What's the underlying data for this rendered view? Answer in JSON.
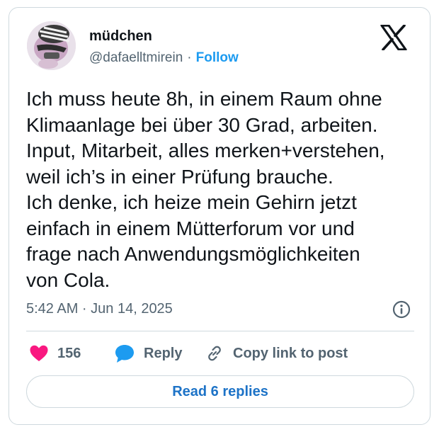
{
  "author": {
    "display_name": "müdchen",
    "handle": "@dafaelltmirein",
    "separator": "·",
    "follow_label": "Follow"
  },
  "tweet": {
    "text": "Ich muss heute 8h, in einem Raum ohne\nKlimaanlage bei über 30 Grad, arbeiten.\nInput, Mitarbeit, alles merken+verstehen,\nweil ich’s in einer Prüfung brauche.\nIch denke, ich heize mein Gehirn jetzt\neinfach in einem Mütterforum vor und\nfrage nach Anwendungsmöglichkeiten\nvon Cola.",
    "timestamp": "5:42 AM · Jun 14, 2025"
  },
  "actions": {
    "like_count": "156",
    "reply_label": "Reply",
    "copy_label": "Copy link to post"
  },
  "footer": {
    "read_replies_label": "Read 6 replies"
  },
  "icons": {
    "brand": "x-logo-icon",
    "info": "info-icon",
    "like": "heart-icon",
    "reply": "speech-bubble-icon",
    "copy": "link-icon"
  },
  "colors": {
    "accent_blue": "#1d9bf0",
    "like_pink": "#f91880",
    "muted_text": "#536471",
    "border": "#cfd9de"
  }
}
